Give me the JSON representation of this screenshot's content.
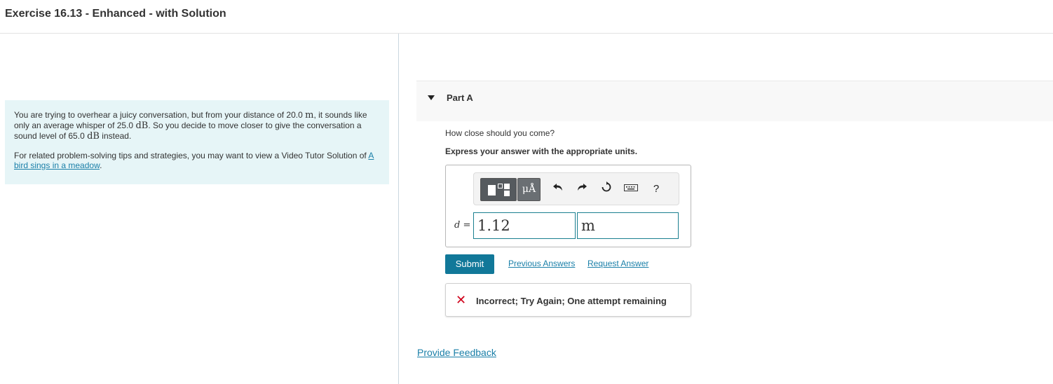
{
  "header": {
    "title": "Exercise 16.13 - Enhanced - with Solution"
  },
  "problem": {
    "p1_a": "You are trying to overhear a juicy conversation, but from your distance of 20.0 ",
    "p1_unit1": "m",
    "p1_b": ", it sounds like only an average whisper of 25.0 ",
    "p1_unit2": "dB",
    "p1_c": ". So you decide to move closer to give the conversation a sound level of 65.0 ",
    "p1_unit3": "dB",
    "p1_d": " instead.",
    "p2_a": "For related problem-solving tips and strategies, you may want to view a Video Tutor Solution of ",
    "p2_link": "A bird sings in a meadow",
    "p2_b": "."
  },
  "part": {
    "title": "Part A",
    "question": "How close should you come?",
    "instruction": "Express your answer with the appropriate units."
  },
  "toolbar": {
    "units_label": "μÅ",
    "icons": [
      "templates-icon",
      "units-icon",
      "undo-icon",
      "redo-icon",
      "reset-icon",
      "keyboard-icon",
      "help-icon"
    ],
    "help_label": "?"
  },
  "answer": {
    "variable": "d",
    "equals": " =",
    "value": "1.12",
    "unit": "m"
  },
  "actions": {
    "submit_label": "Submit",
    "previous_answers": "Previous Answers",
    "request_answer": "Request Answer"
  },
  "feedback": {
    "message": "Incorrect; Try Again; One attempt remaining",
    "color": "#d0021b"
  },
  "footer": {
    "provide_feedback": "Provide Feedback"
  },
  "colors": {
    "accent": "#117899",
    "link": "#1a7fa8",
    "problem_bg": "#e6f5f7"
  }
}
